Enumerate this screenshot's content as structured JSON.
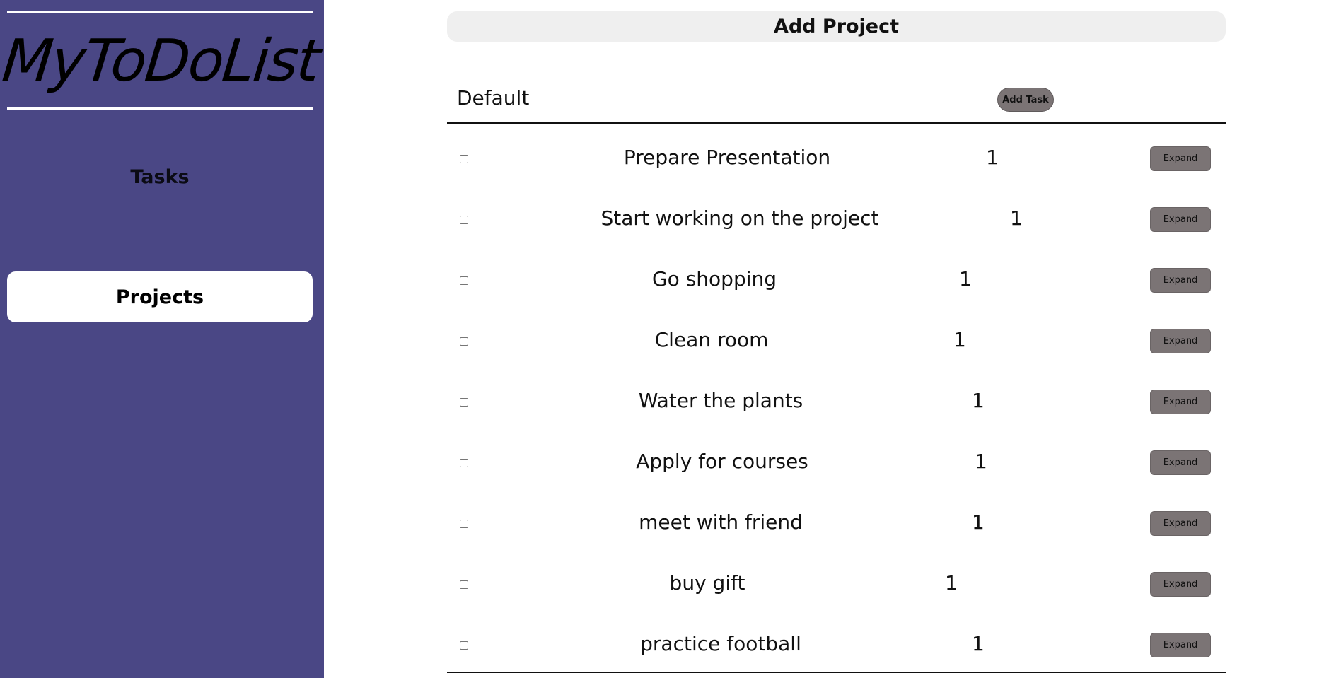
{
  "app": {
    "logo": "MyToDoList"
  },
  "sidebar": {
    "items": [
      {
        "label": "Tasks"
      },
      {
        "label": "Projects",
        "active": true
      }
    ]
  },
  "main": {
    "add_project_label": "Add Project",
    "project": {
      "name": "Default",
      "add_task_label": "Add Task",
      "tasks": [
        {
          "title": "Prepare Presentation",
          "priority": "1",
          "expand_label": "Expand"
        },
        {
          "title": "Start working on the project",
          "priority": "1",
          "expand_label": "Expand"
        },
        {
          "title": "Go shopping",
          "priority": "1",
          "expand_label": "Expand"
        },
        {
          "title": "Clean room",
          "priority": "1",
          "expand_label": "Expand"
        },
        {
          "title": "Water the plants",
          "priority": "1",
          "expand_label": "Expand"
        },
        {
          "title": "Apply for courses",
          "priority": "1",
          "expand_label": "Expand"
        },
        {
          "title": "meet with friend",
          "priority": "1",
          "expand_label": "Expand"
        },
        {
          "title": "buy gift",
          "priority": "1",
          "expand_label": "Expand"
        },
        {
          "title": "practice football",
          "priority": "1",
          "expand_label": "Expand"
        }
      ]
    }
  },
  "colors": {
    "sidebar_bg": "#4a4785",
    "button_bg": "#7b7475",
    "add_project_bg": "#efefef"
  }
}
